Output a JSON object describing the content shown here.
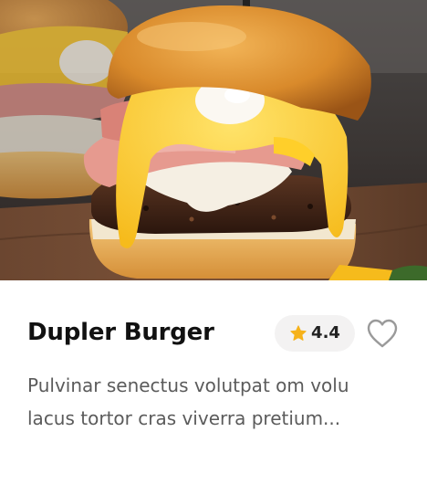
{
  "product": {
    "image_alt": "Burger with ham, melted cheese, poached egg and hollandaise sauce",
    "name": "Dupler Burger",
    "rating": "4.4",
    "rating_icon": "star-icon",
    "favorite_icon": "heart-outline-icon",
    "description_lines": [
      "Pulvinar senectus volutpat om volu",
      "lacus tortor cras viverra pretium..."
    ]
  },
  "colors": {
    "star": "#F6B21A",
    "rating_bg": "#F3F2F2",
    "title": "#111111",
    "description": "#5B5B5B",
    "heart_stroke": "#9A9A9A"
  }
}
